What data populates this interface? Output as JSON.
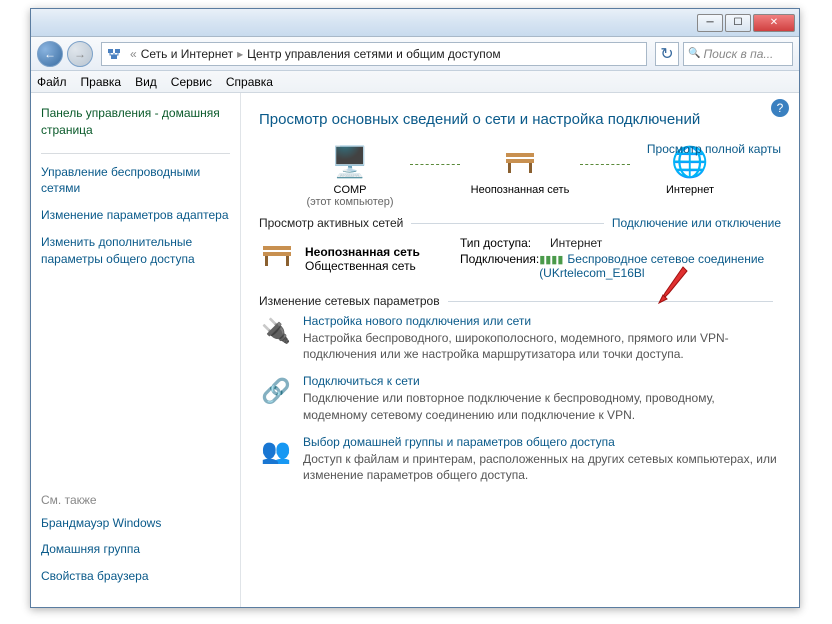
{
  "breadcrumb": {
    "part1": "Сеть и Интернет",
    "part2": "Центр управления сетями и общим доступом"
  },
  "search": {
    "placeholder": "Поиск в па..."
  },
  "menu": {
    "file": "Файл",
    "edit": "Правка",
    "view": "Вид",
    "service": "Сервис",
    "help": "Справка"
  },
  "sidebar": {
    "home": "Панель управления - домашняя страница",
    "links": {
      "wireless": "Управление беспроводными сетями",
      "adapter": "Изменение параметров адаптера",
      "sharing": "Изменить дополнительные параметры общего доступа"
    },
    "also_label": "См. также",
    "also": {
      "firewall": "Брандмауэр Windows",
      "homegroup": "Домашняя группа",
      "browser": "Свойства браузера"
    }
  },
  "main": {
    "heading": "Просмотр основных сведений о сети и настройка подключений",
    "map_link": "Просмотр полной карты",
    "nodes": {
      "comp": {
        "label": "COMP",
        "sub": "(этот компьютер)"
      },
      "unknown": {
        "label": "Неопознанная сеть"
      },
      "internet": {
        "label": "Интернет"
      }
    },
    "active_title": "Просмотр активных сетей",
    "connect_link": "Подключение или отключение",
    "active_net": {
      "name": "Неопознанная сеть",
      "type": "Общественная сеть"
    },
    "kv": {
      "access_k": "Тип доступа:",
      "access_v": "Интернет",
      "conn_k": "Подключения:",
      "conn_v": "Беспроводное сетевое соединение (UKrtelecom_E16Bl"
    },
    "change_title": "Изменение сетевых параметров",
    "tasks": {
      "t1": {
        "title": "Настройка нового подключения или сети",
        "desc": "Настройка беспроводного, широкополосного, модемного, прямого или VPN-подключения или же настройка маршрутизатора или точки доступа."
      },
      "t2": {
        "title": "Подключиться к сети",
        "desc": "Подключение или повторное подключение к беспроводному, проводному, модемному сетевому соединению или подключение к VPN."
      },
      "t3": {
        "title": "Выбор домашней группы и параметров общего доступа",
        "desc": "Доступ к файлам и принтерам, расположенных на других сетевых компьютерах, или изменение параметров общего доступа."
      }
    }
  }
}
